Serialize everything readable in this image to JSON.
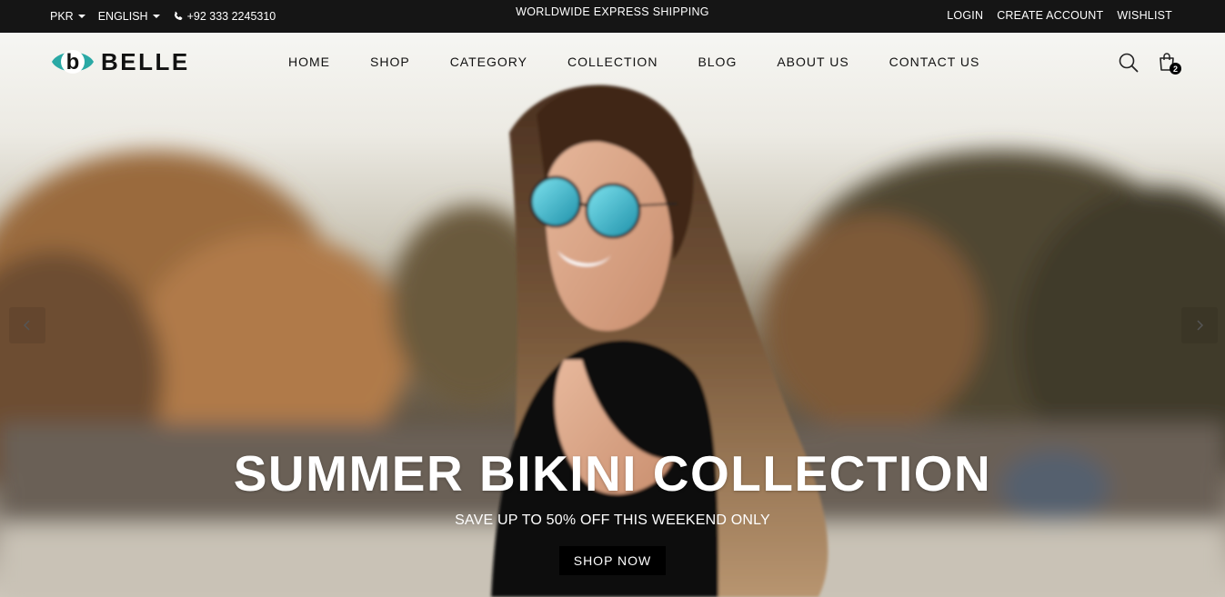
{
  "topbar": {
    "currency": "PKR",
    "language": "ENGLISH",
    "phone": "+92 333 2245310",
    "announcement": "WORLDWIDE EXPRESS SHIPPING",
    "links": [
      "LOGIN",
      "CREATE ACCOUNT",
      "WISHLIST"
    ]
  },
  "header": {
    "logo_text": "BELLE",
    "nav": [
      "HOME",
      "SHOP",
      "CATEGORY",
      "COLLECTION",
      "BLOG",
      "ABOUT US",
      "CONTACT US"
    ],
    "cart_count": "2"
  },
  "slide": {
    "title": "SUMMER BIKINI COLLECTION",
    "subtitle": "SAVE UP TO 50% OFF THIS WEEKEND ONLY",
    "button": "SHOP NOW"
  },
  "colors": {
    "topbar_bg": "#151515",
    "logo_accent": "#2aa9a5",
    "button_bg": "#000000"
  },
  "icons": [
    "phone-icon",
    "search-icon",
    "cart-icon",
    "chevron-left-icon",
    "chevron-right-icon"
  ]
}
